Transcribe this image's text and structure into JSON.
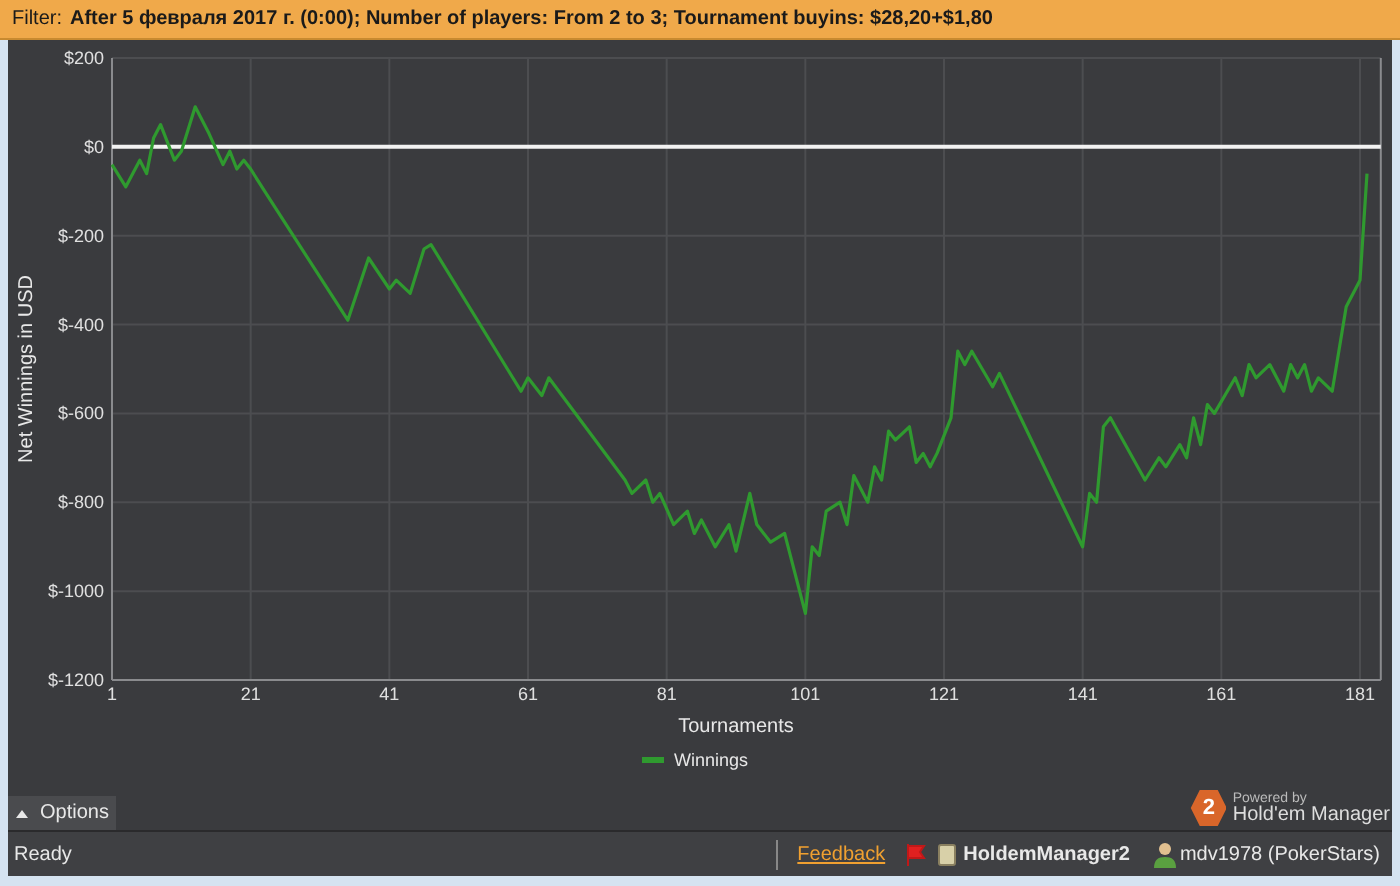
{
  "filter_bar": {
    "label": "Filter:",
    "text": "After 5 февраля 2017 г. (0:00); Number of players: From 2 to 3; Tournament buyins: $28,20+$1,80"
  },
  "chart": {
    "chart_data": {
      "type": "line",
      "xlabel": "Tournaments",
      "ylabel": "Net Winnings in USD",
      "x": [
        1,
        3,
        5,
        6,
        7,
        8,
        10,
        11,
        13,
        15,
        17,
        18,
        19,
        20,
        21,
        23,
        35,
        38,
        41,
        42,
        44,
        46,
        47,
        60,
        61,
        63,
        64,
        75,
        76,
        78,
        79,
        80,
        82,
        84,
        85,
        86,
        88,
        90,
        91,
        93,
        94,
        96,
        98,
        101,
        102,
        103,
        104,
        106,
        107,
        108,
        110,
        111,
        112,
        113,
        114,
        116,
        117,
        118,
        119,
        120,
        122,
        123,
        124,
        125,
        128,
        129,
        141,
        142,
        143,
        144,
        145,
        150,
        152,
        153,
        155,
        156,
        157,
        158,
        159,
        160,
        163,
        164,
        165,
        166,
        168,
        170,
        171,
        172,
        173,
        174,
        175,
        177,
        179,
        181,
        182
      ],
      "series": [
        {
          "name": "Winnings",
          "color": "#2f9a2f",
          "values": [
            -40,
            -90,
            -30,
            -60,
            20,
            50,
            -30,
            -10,
            90,
            30,
            -40,
            -10,
            -50,
            -30,
            -50,
            -100,
            -390,
            -250,
            -320,
            -300,
            -330,
            -230,
            -220,
            -550,
            -520,
            -560,
            -520,
            -750,
            -780,
            -750,
            -800,
            -780,
            -850,
            -820,
            -870,
            -840,
            -900,
            -850,
            -910,
            -780,
            -850,
            -890,
            -870,
            -1050,
            -900,
            -920,
            -820,
            -800,
            -850,
            -740,
            -800,
            -720,
            -750,
            -640,
            -660,
            -630,
            -710,
            -690,
            -720,
            -690,
            -610,
            -460,
            -490,
            -460,
            -540,
            -510,
            -900,
            -780,
            -800,
            -630,
            -610,
            -750,
            -700,
            -720,
            -670,
            -700,
            -610,
            -670,
            -580,
            -600,
            -520,
            -560,
            -490,
            -520,
            -490,
            -550,
            -490,
            -520,
            -490,
            -550,
            -520,
            -550,
            -360,
            -300,
            -60
          ]
        }
      ],
      "grid": true,
      "xlim": [
        1,
        184
      ],
      "ylim": [
        -1200,
        200
      ],
      "xticks": [
        1,
        21,
        41,
        61,
        81,
        101,
        121,
        141,
        161,
        181
      ],
      "yticks": [
        {
          "value": 200,
          "label": "$200"
        },
        {
          "value": 0,
          "label": "$0"
        },
        {
          "value": -200,
          "label": "$-200"
        },
        {
          "value": -400,
          "label": "$-400"
        },
        {
          "value": -600,
          "label": "$-600"
        },
        {
          "value": -800,
          "label": "$-800"
        },
        {
          "value": -1000,
          "label": "$-1000"
        },
        {
          "value": -1200,
          "label": "$-1200"
        }
      ]
    }
  },
  "options_tab": {
    "label": "Options",
    "expanded": false
  },
  "logo": {
    "badge": "2",
    "powered": "Powered by",
    "product": "Hold'em Manager"
  },
  "status_bar": {
    "status": "Ready",
    "feedback": "Feedback",
    "app": "HoldemManager2",
    "user": "mdv1978 (PokerStars)"
  }
}
